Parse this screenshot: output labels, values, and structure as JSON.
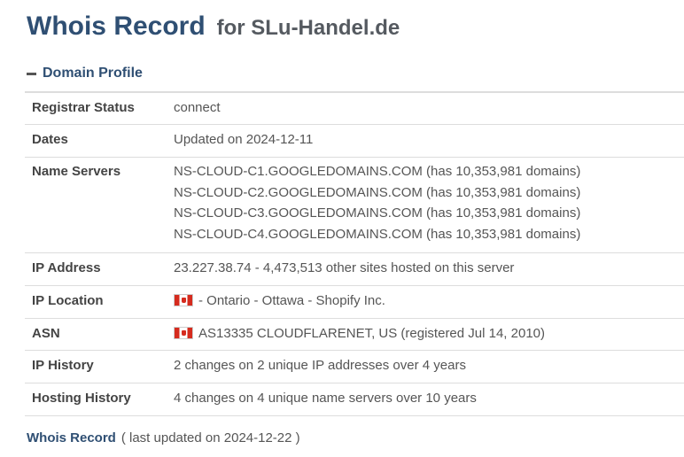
{
  "title": {
    "main": "Whois Record",
    "for_text": "for SLu-Handel.de"
  },
  "section": {
    "label": "Domain Profile",
    "icon": "minus-icon"
  },
  "rows": {
    "registrar_status": {
      "label": "Registrar Status",
      "value": "connect"
    },
    "dates": {
      "label": "Dates",
      "value": "Updated on 2024-12-11"
    },
    "name_servers": {
      "label": "Name Servers",
      "values": [
        "NS-CLOUD-C1.GOOGLEDOMAINS.COM (has 10,353,981 domains)",
        "NS-CLOUD-C2.GOOGLEDOMAINS.COM (has 10,353,981 domains)",
        "NS-CLOUD-C3.GOOGLEDOMAINS.COM (has 10,353,981 domains)",
        "NS-CLOUD-C4.GOOGLEDOMAINS.COM (has 10,353,981 domains)"
      ]
    },
    "ip_address": {
      "label": "IP Address",
      "value": "23.227.38.74 - 4,473,513 other sites hosted on this server"
    },
    "ip_location": {
      "label": "IP Location",
      "flag": "canada-flag-icon",
      "value": "- Ontario - Ottawa - Shopify Inc."
    },
    "asn": {
      "label": "ASN",
      "flag": "canada-flag-icon",
      "value": "AS13335 CLOUDFLARENET, US (registered Jul 14, 2010)"
    },
    "ip_history": {
      "label": "IP History",
      "value": "2 changes on 2 unique IP addresses over 4 years"
    },
    "hosting_history": {
      "label": "Hosting History",
      "value": "4 changes on 4 unique name servers over 10 years"
    }
  },
  "footer": {
    "link": "Whois Record",
    "note": "( last updated on 2024-12-22 )"
  },
  "colors": {
    "title": "#2f4f73",
    "text": "#555555",
    "border": "#dddddd",
    "flag_red": "#d52b1e"
  }
}
